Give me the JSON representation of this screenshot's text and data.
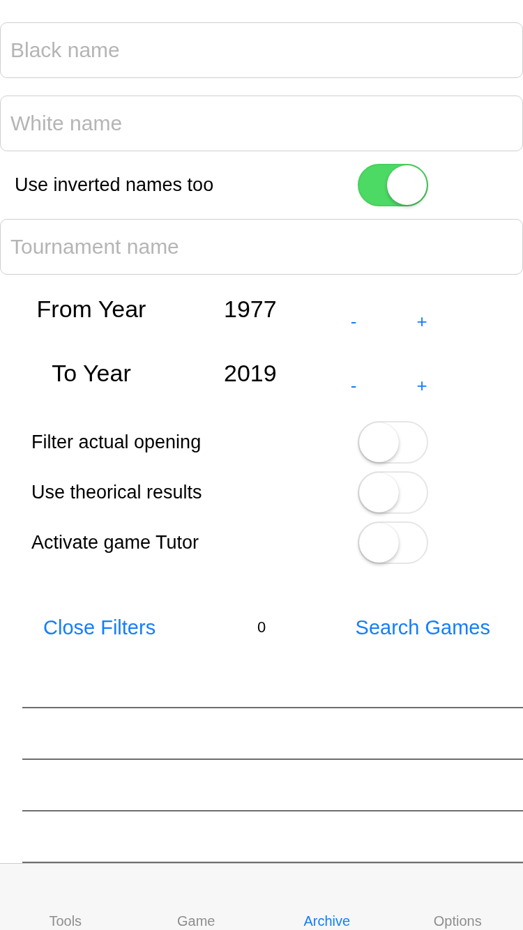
{
  "form": [
    {
      "kind": "field",
      "placeholder": "Black name"
    },
    {
      "kind": "field",
      "placeholder": "White name"
    },
    {
      "kind": "switch",
      "label": "Use inverted names too",
      "on": true
    },
    {
      "kind": "field",
      "placeholder": "Tournament name"
    }
  ],
  "year_range": [
    {
      "label": "From Year",
      "value": "1977",
      "decrement": "-",
      "increment": "+"
    },
    {
      "label": "To Year",
      "value": "2019",
      "decrement": "-",
      "increment": "+"
    }
  ],
  "options": [
    {
      "label": "Filter actual opening",
      "on": false
    },
    {
      "label": "Use theorical results",
      "on": false
    },
    {
      "label": "Activate game Tutor",
      "on": false
    }
  ],
  "actions": {
    "close": "Close Filters",
    "count": "0",
    "search": "Search Games"
  },
  "tab_bar": [
    {
      "label": "Tools",
      "selected": false
    },
    {
      "label": "Game",
      "selected": false
    },
    {
      "label": "Archive",
      "selected": true
    },
    {
      "label": "Options",
      "selected": false
    }
  ]
}
